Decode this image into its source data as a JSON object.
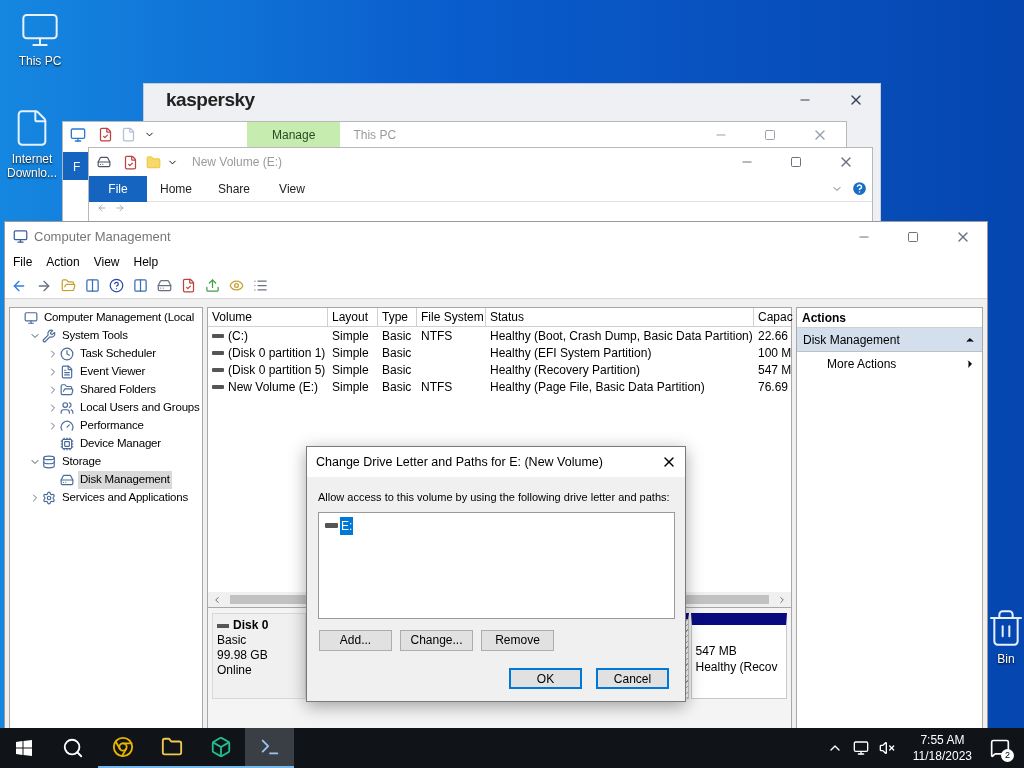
{
  "desktop_icons": [
    {
      "kind": "pc",
      "label": "This PC"
    },
    {
      "kind": "file",
      "label": "Internet Downlo..."
    },
    {
      "kind": "bin",
      "label": "Bin"
    }
  ],
  "kaspersky_window": {
    "title": "kaspersky"
  },
  "this_pc_window": {
    "file_tab": "F",
    "context_tab": "Manage",
    "title": "This PC"
  },
  "new_volume_window": {
    "title": "New Volume (E:)",
    "ribbon_tabs": [
      {
        "label": "File",
        "selected": true
      },
      {
        "label": "Home",
        "selected": false
      },
      {
        "label": "Share",
        "selected": false
      },
      {
        "label": "View",
        "selected": false
      }
    ],
    "ribbon_help": true
  },
  "computer_management": {
    "title": "Computer Management",
    "menu": [
      "File",
      "Action",
      "View",
      "Help"
    ],
    "tree": [
      {
        "kind": "computer",
        "label": "Computer Management (Local",
        "selected": false,
        "children": [
          {
            "kind": "tools",
            "label": "System Tools",
            "expanded": true,
            "selected": false,
            "children": [
              {
                "kind": "clock",
                "label": "Task Scheduler",
                "expanded": false,
                "selected": false
              },
              {
                "kind": "log",
                "label": "Event Viewer",
                "expanded": false,
                "selected": false
              },
              {
                "kind": "share",
                "label": "Shared Folders",
                "expanded": false,
                "selected": false
              },
              {
                "kind": "users",
                "label": "Local Users and Groups",
                "expanded": false,
                "selected": false
              },
              {
                "kind": "gauge",
                "label": "Performance",
                "expanded": false,
                "selected": false
              },
              {
                "kind": "device",
                "label": "Device Manager",
                "selected": false
              }
            ]
          },
          {
            "kind": "storage",
            "label": "Storage",
            "expanded": true,
            "selected": false,
            "children": [
              {
                "kind": "disk",
                "label": "Disk Management",
                "selected": true
              }
            ]
          },
          {
            "kind": "services",
            "label": "Services and Applications",
            "expanded": false,
            "selected": false
          }
        ]
      }
    ],
    "volume_table": {
      "columns": [
        "Volume",
        "Layout",
        "Type",
        "File System",
        "Status",
        "Capac"
      ],
      "rows": [
        [
          "(C:)",
          "Simple",
          "Basic",
          "NTFS",
          "Healthy (Boot, Crash Dump, Basic Data Partition)",
          "22.66"
        ],
        [
          "(Disk 0 partition 1)",
          "Simple",
          "Basic",
          "",
          "Healthy (EFI System Partition)",
          "100 M"
        ],
        [
          "(Disk 0 partition 5)",
          "Simple",
          "Basic",
          "",
          "Healthy (Recovery Partition)",
          "547 M"
        ],
        [
          "New Volume (E:)",
          "Simple",
          "Basic",
          "NTFS",
          "Healthy (Page File, Basic Data Partition)",
          "76.69"
        ]
      ]
    },
    "disk": {
      "name": "Disk 0",
      "type": "Basic",
      "size": "99.98 GB",
      "status": "Online"
    },
    "partition": {
      "size": "547 MB",
      "status": "Healthy (Recov"
    },
    "actions": {
      "header": "Actions",
      "items": [
        {
          "label": "Disk Management",
          "kind": "section",
          "selected": true
        },
        {
          "label": "More Actions",
          "kind": "submenu",
          "selected": false
        }
      ]
    }
  },
  "dialog": {
    "title": "Change Drive Letter and Paths for E: (New Volume)",
    "instruction": "Allow access to this volume by using the following drive letter and paths:",
    "paths": [
      {
        "label": "E:",
        "selected": true
      }
    ],
    "buttons": [
      "Add...",
      "Change...",
      "Remove"
    ],
    "ok": "OK",
    "cancel": "Cancel"
  },
  "taskbar": {
    "apps": [
      {
        "kind": "chrome",
        "active": false
      },
      {
        "kind": "folder",
        "active": false
      },
      {
        "kind": "box",
        "active": false
      },
      {
        "kind": "console",
        "active": true
      }
    ],
    "time": "7:55 AM",
    "date": "11/18/2023",
    "notifications": "2"
  }
}
